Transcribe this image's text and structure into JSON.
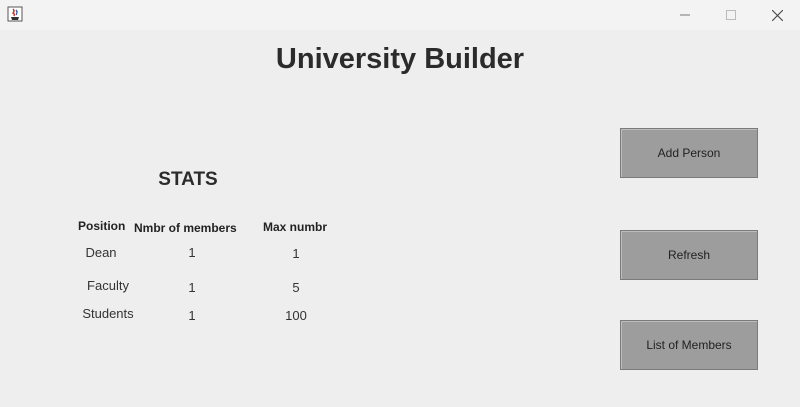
{
  "window": {
    "app_icon": "java-cup-icon",
    "controls": [
      "minimize-icon",
      "maximize-icon",
      "close-icon"
    ]
  },
  "main": {
    "title": "University Builder",
    "stats_title": "STATS"
  },
  "table": {
    "headers": [
      "Position",
      "Nmbr of members",
      "Max numbr"
    ],
    "rows": [
      {
        "position": "Dean",
        "members": "1",
        "max": "1"
      },
      {
        "position": "Faculty",
        "members": "1",
        "max": "5"
      },
      {
        "position": "Students",
        "members": "1",
        "max": "100"
      }
    ]
  },
  "buttons": {
    "add_person": "Add Person",
    "refresh": "Refresh",
    "list_members": "List of Members"
  },
  "colors": {
    "background": "#eeeeee",
    "button": "#9d9d9d"
  }
}
